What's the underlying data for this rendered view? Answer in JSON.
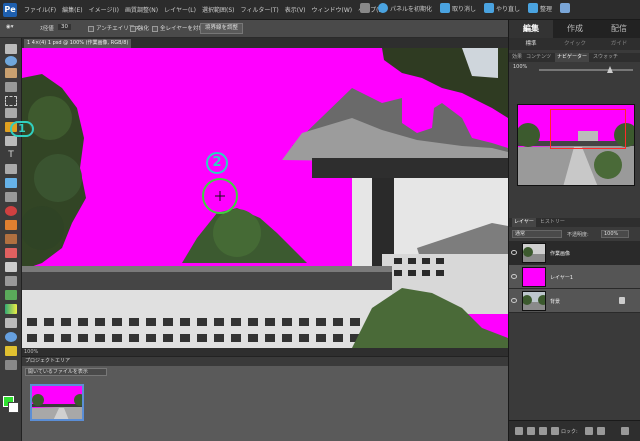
{
  "menu": {
    "items": [
      "ファイル(F)",
      "編集(E)",
      "イメージ(I)",
      "画質調整(N)",
      "レイヤー(L)",
      "選択範囲(S)",
      "フィルター(T)",
      "表示(V)",
      "ウィンドウ(W)",
      "ヘルプ(H)"
    ],
    "panel_reset": "パネルを初期化",
    "undo": "取り消し",
    "redo": "やり直し",
    "organizer": "整理"
  },
  "options": {
    "brush_size_label": "ｽ径値",
    "brush_size_value": "30",
    "antialias": "アンチエイリアス",
    "auto_enhance": "強化",
    "sample_all_layers": "全レイヤーを対象",
    "refine_edge": "境界線を調整"
  },
  "document": {
    "tab_title": "1 4×(4) 1 psd @ 100% (作業画像, RGB/8)",
    "status": "100%"
  },
  "project_bin": {
    "header": "プロジェクトエリア",
    "select": "開いているファイルを表示"
  },
  "mode_tabs": [
    "編集",
    "作成",
    "配信"
  ],
  "sub_tabs": [
    "標準",
    "クイック",
    "ガイド"
  ],
  "panel_tabs_top": [
    "効果",
    "コンテンツ",
    "ナビゲーター",
    "スウォッチ"
  ],
  "navigator": {
    "zoom": "100%"
  },
  "layers": {
    "tabs": [
      "レイヤー",
      "ヒストリー"
    ],
    "blend_mode": "通常",
    "opacity_label": "不透明度:",
    "opacity": "100%",
    "items": [
      {
        "name": "作業画像"
      },
      {
        "name": "レイヤー1"
      },
      {
        "name": "背景"
      }
    ],
    "bottom_label": "ロック:"
  },
  "annotations": [
    "1",
    "2"
  ],
  "colors": {
    "magenta": "#ff00ff",
    "annotation": "#30d0c0",
    "selection_circle": "#40d040"
  }
}
